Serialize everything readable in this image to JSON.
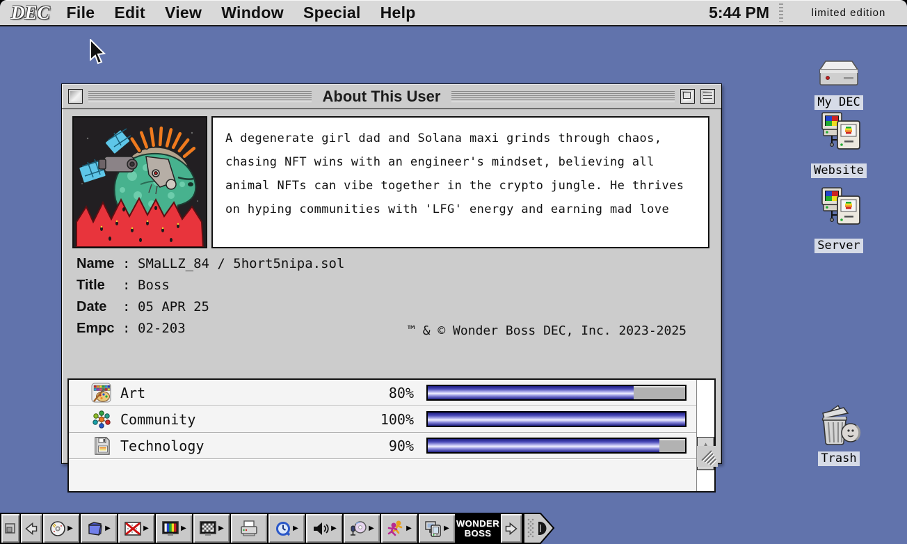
{
  "menu_bar": {
    "logo": "DEC",
    "items": [
      "File",
      "Edit",
      "View",
      "Window",
      "Special",
      "Help"
    ],
    "clock": "5:44 PM",
    "edition": "limited edition"
  },
  "window": {
    "title": "About This User",
    "bio": "A degenerate girl dad and Solana maxi grinds through chaos, chasing NFT wins with an engineer's mindset, believing all animal NFTs can vibe together in the crypto jungle. He thrives on hyping communities with 'LFG' energy and earning mad love",
    "fields": [
      {
        "label": "Name",
        "value": "SMaLLZ_84 / 5hort5nipa.sol"
      },
      {
        "label": "Title",
        "value": "Boss"
      },
      {
        "label": "Date",
        "value": "05 APR 25"
      },
      {
        "label": "Empc",
        "value": "02-203"
      }
    ],
    "copyright": "™ & © Wonder Boss DEC, Inc. 2023-2025",
    "skills": [
      {
        "icon": "palette-icon",
        "label": "Art",
        "percent": "80%",
        "value": 80
      },
      {
        "icon": "network-icon",
        "label": "Community",
        "percent": "100%",
        "value": 100
      },
      {
        "icon": "floppy-icon",
        "label": "Technology",
        "percent": "90%",
        "value": 90
      }
    ]
  },
  "desktop_icons": [
    {
      "icon": "hard-drive-icon",
      "label": "My DEC"
    },
    {
      "icon": "network-computers-icon",
      "label": "Website"
    },
    {
      "icon": "network-computers-icon",
      "label": "Server"
    },
    {
      "icon": "trash-icon",
      "label": "Trash"
    }
  ],
  "control_strip": {
    "badge_line1": "WONDER",
    "badge_line2": "BOSS",
    "buttons": [
      "collapse-tab",
      "scroll-left",
      "cd",
      "file-sharing",
      "desktop-pattern",
      "color-depth",
      "resolution",
      "printer",
      "quicktime",
      "volume",
      "sound-input",
      "energy",
      "sync",
      "wonder-boss",
      "scroll-right",
      "end-cap"
    ]
  },
  "colors": {
    "desktop_background": "#6173ac",
    "window_chrome": "#cccccc",
    "progress_blue": "#3434a8",
    "icon_label_background": "#d6dbe7",
    "mute_cross_red": "#cc1111"
  }
}
